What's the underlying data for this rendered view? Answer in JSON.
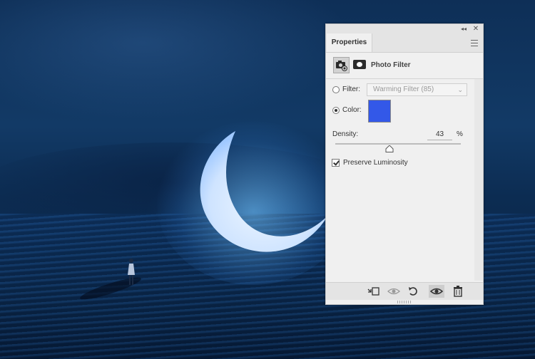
{
  "panel": {
    "title_tab": "Properties",
    "titlebar_icons": [
      "collapse-double-arrow-icon",
      "close-icon"
    ],
    "collapse_glyph": "◂◂",
    "close_glyph": "✕",
    "adjustment_title": "Photo Filter"
  },
  "filter": {
    "label": "Filter:",
    "value": "Warming Filter (85)",
    "selected": false
  },
  "color": {
    "label": "Color:",
    "swatch_hex": "#3358e8",
    "selected": true
  },
  "density": {
    "label": "Density:",
    "value": "43",
    "unit": "%",
    "level_percent": 43
  },
  "preserve_luminosity": {
    "label": "Preserve Luminosity",
    "checked": true
  },
  "bottom_icons": [
    "clip-to-layer-icon",
    "view-previous-state-icon",
    "reset-icon",
    "visibility-eye-icon",
    "trash-icon"
  ],
  "colors": {
    "panel_bg": "#f0f0f0",
    "swatch": "#3358e8",
    "background_night": "#0e2f57",
    "moon_glow": "#9fd4ff"
  }
}
